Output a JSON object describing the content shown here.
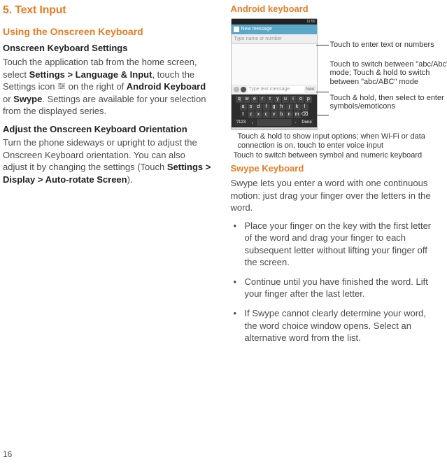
{
  "page_number": "16",
  "left": {
    "section_heading": "5.  Text Input",
    "sub_heading": "Using the Onscreen Keyboard",
    "settings_heading": "Onscreen Keyboard Settings",
    "para1_pre": "Touch the application tab from the home screen, select ",
    "para1_b1": "Settings > Language & Input",
    "para1_mid1": ", touch the Settings icon ",
    "para1_mid2": " on the right of ",
    "para1_b2": "Android Keyboard",
    "para1_or": " or ",
    "para1_b3": "Swype",
    "para1_post": ". Settings are available for your selection from the displayed series.",
    "adjust_heading": "Adjust the Onscreen Keyboard Orientation",
    "para2_pre": "Turn the phone sideways or upright to adjust the Onscreen Keyboard orientation. You can also adjust it by changing the settings (Touch ",
    "para2_b": "Settings > Display > Auto-rotate Screen",
    "para2_post": ")."
  },
  "right": {
    "android_heading": "Android keyboard",
    "callout_enter_text": "Touch to enter text or numbers",
    "callout_switch_abc": "Touch to switch between \"abc/Abc\" mode; Touch & hold to switch between \"abc/ABC\" mode",
    "callout_symbols": "Touch & hold, then select to enter symbols/emoticons",
    "under1": "Touch & hold to show input options; when Wi-Fi or data connection is on, touch to enter voice input",
    "under2": "Touch to switch between symbol and numeric keyboard",
    "swype_heading": "Swype Keyboard",
    "swype_intro": "Swype lets you enter a word with one continuous motion: just drag your finger over the letters in the word.",
    "bul1": "Place your finger on the key with the first letter of the word and drag your finger to each subsequent letter without lifting your finger off the screen.",
    "bul2": "Continue until you have finished the word. Lift your finger after the last letter.",
    "bul3": "If Swype cannot clearly determine your word, the word choice window opens. Select an alternative word from the list."
  },
  "phone": {
    "time": "11:50",
    "header": "New message",
    "to_placeholder": "Type name or number",
    "input_placeholder": "Type text message",
    "next": "Next",
    "done": "Done",
    "sym": "?123",
    "row1": [
      "q",
      "w",
      "e",
      "r",
      "t",
      "y",
      "u",
      "i",
      "o",
      "p"
    ],
    "row2": [
      "a",
      "s",
      "d",
      "f",
      "g",
      "h",
      "j",
      "k",
      "l"
    ],
    "row3": [
      "z",
      "x",
      "c",
      "v",
      "b",
      "n",
      "m"
    ]
  }
}
